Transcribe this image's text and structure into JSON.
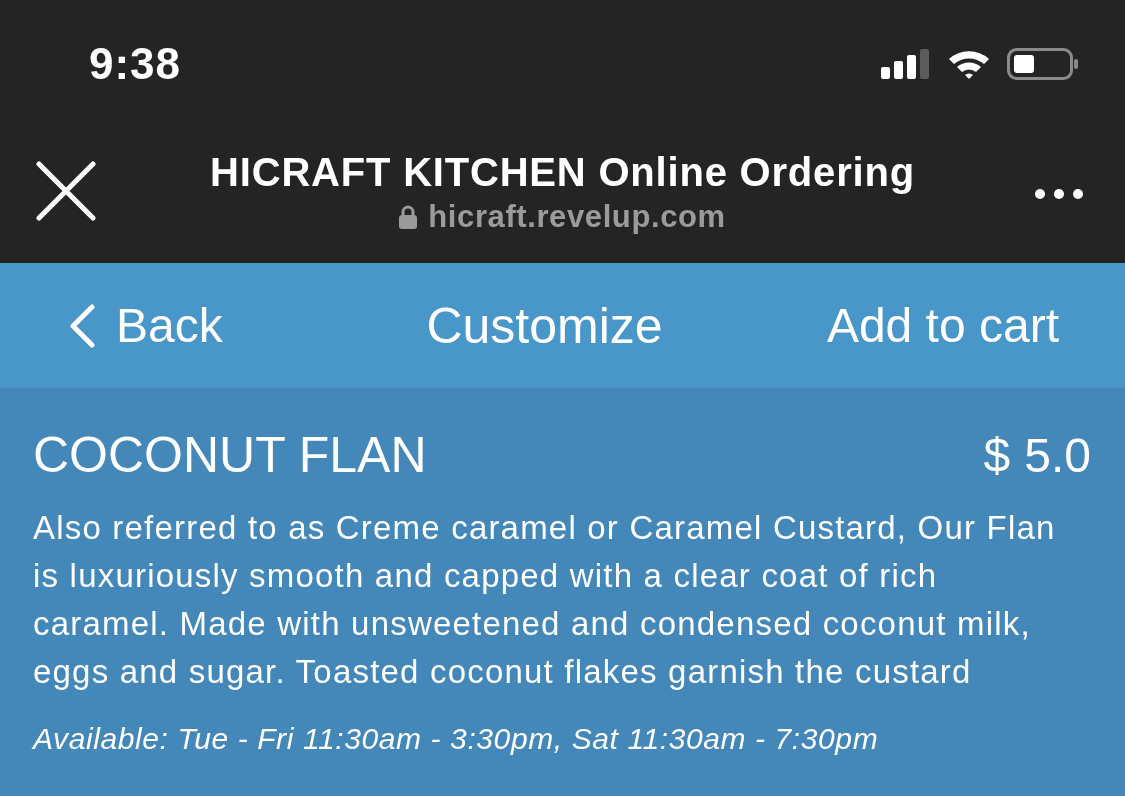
{
  "status_bar": {
    "time": "9:38"
  },
  "browser": {
    "title": "HICRAFT KITCHEN Online Ordering",
    "url": "hicraft.revelup.com"
  },
  "nav": {
    "back": "Back",
    "title": "Customize",
    "action": "Add to cart"
  },
  "item": {
    "name": "COCONUT FLAN",
    "price_symbol": "$",
    "price_amount": "5.0",
    "description": "Also referred to as Creme caramel or Caramel Custard, Our Flan is luxuriously smooth and capped with a clear coat of rich caramel. Made with unsweetened and condensed coconut milk, eggs and sugar. Toasted coconut flakes garnish the custard",
    "availability": "Available: Tue - Fri 11:30am - 3:30pm, Sat 11:30am - 7:30pm"
  }
}
